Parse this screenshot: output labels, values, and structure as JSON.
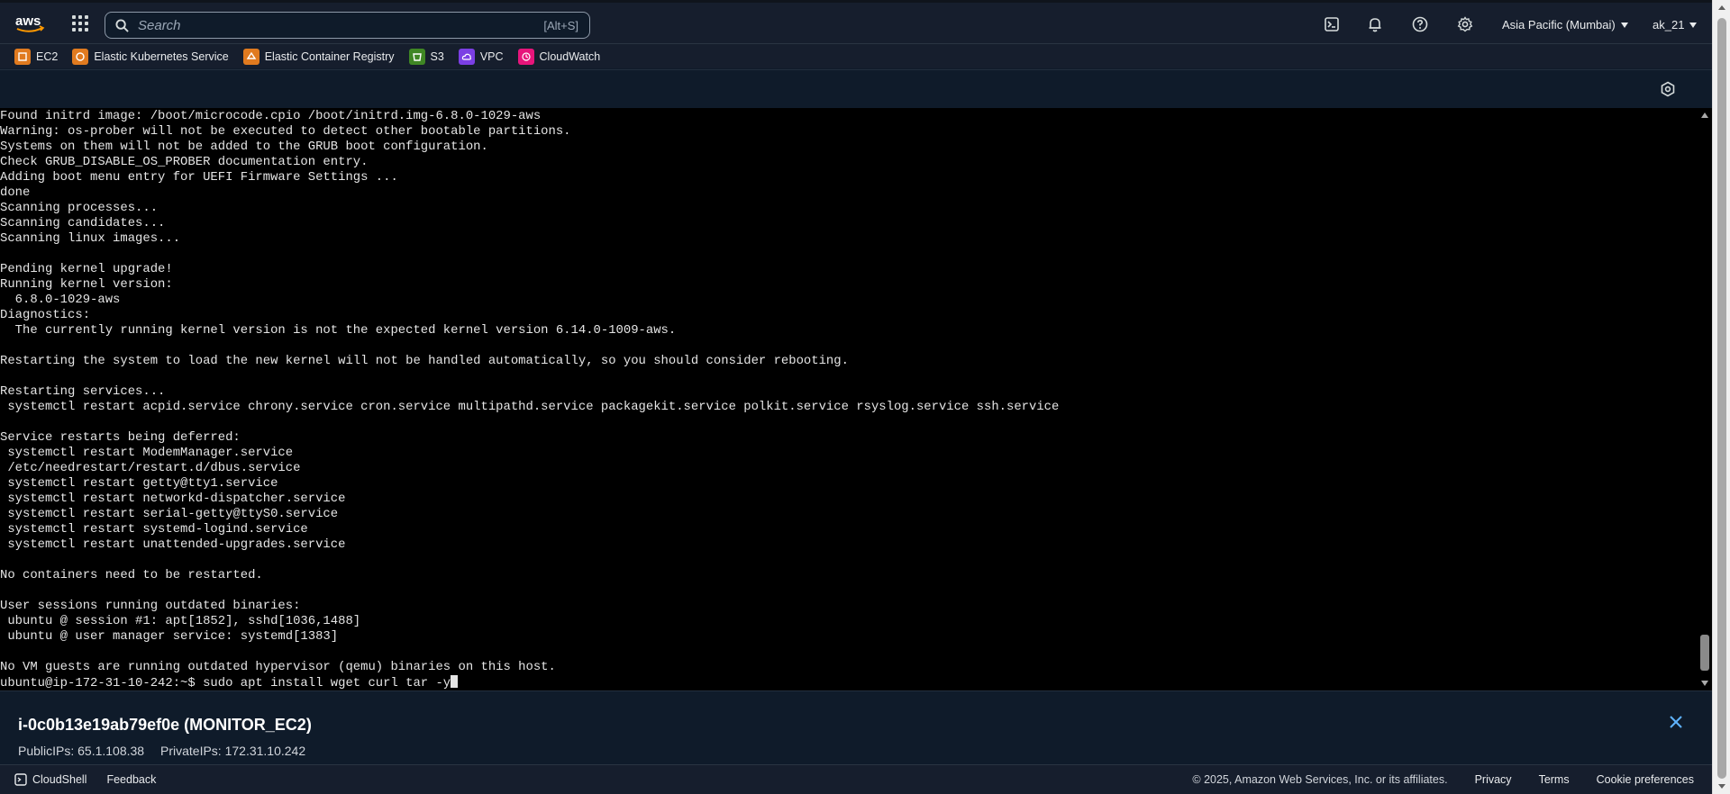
{
  "nav": {
    "logo_text": "aws",
    "search": {
      "placeholder": "Search",
      "shortcut": "[Alt+S]"
    },
    "icons": [
      "cloudshell-icon",
      "bell-icon",
      "help-icon",
      "gear-icon"
    ],
    "region": "Asia Pacific (Mumbai)",
    "user": "ak_21"
  },
  "favorites": [
    {
      "label": "EC2",
      "color": "#e07a1f"
    },
    {
      "label": "Elastic Kubernetes Service",
      "color": "#e07a1f"
    },
    {
      "label": "Elastic Container Registry",
      "color": "#e07a1f"
    },
    {
      "label": "S3",
      "color": "#3f8624"
    },
    {
      "label": "VPC",
      "color": "#7b3fe4"
    },
    {
      "label": "CloudWatch",
      "color": "#e7157b"
    }
  ],
  "terminal": {
    "lines": [
      "Found initrd image: /boot/microcode.cpio /boot/initrd.img-6.8.0-1029-aws",
      "Warning: os-prober will not be executed to detect other bootable partitions.",
      "Systems on them will not be added to the GRUB boot configuration.",
      "Check GRUB_DISABLE_OS_PROBER documentation entry.",
      "Adding boot menu entry for UEFI Firmware Settings ...",
      "done",
      "Scanning processes...",
      "Scanning candidates...",
      "Scanning linux images...",
      "",
      "Pending kernel upgrade!",
      "Running kernel version:",
      "  6.8.0-1029-aws",
      "Diagnostics:",
      "  The currently running kernel version is not the expected kernel version 6.14.0-1009-aws.",
      "",
      "Restarting the system to load the new kernel will not be handled automatically, so you should consider rebooting.",
      "",
      "Restarting services...",
      " systemctl restart acpid.service chrony.service cron.service multipathd.service packagekit.service polkit.service rsyslog.service ssh.service",
      "",
      "Service restarts being deferred:",
      " systemctl restart ModemManager.service",
      " /etc/needrestart/restart.d/dbus.service",
      " systemctl restart getty@tty1.service",
      " systemctl restart networkd-dispatcher.service",
      " systemctl restart serial-getty@ttyS0.service",
      " systemctl restart systemd-logind.service",
      " systemctl restart unattended-upgrades.service",
      "",
      "No containers need to be restarted.",
      "",
      "User sessions running outdated binaries:",
      " ubuntu @ session #1: apt[1852], sshd[1036,1488]",
      " ubuntu @ user manager service: systemd[1383]",
      "",
      "No VM guests are running outdated hypervisor (qemu) binaries on this host."
    ],
    "prompt": "ubuntu@ip-172-31-10-242:~$ sudo apt install wget curl tar -y"
  },
  "instance": {
    "title": "i-0c0b13e19ab79ef0e (MONITOR_EC2)",
    "public_ips": "PublicIPs: 65.1.108.38",
    "private_ips": "PrivateIPs: 172.31.10.242"
  },
  "footer": {
    "cloudshell": "CloudShell",
    "feedback": "Feedback",
    "copyright": "© 2025, Amazon Web Services, Inc. or its affiliates.",
    "privacy": "Privacy",
    "terms": "Terms",
    "cookies": "Cookie preferences"
  }
}
